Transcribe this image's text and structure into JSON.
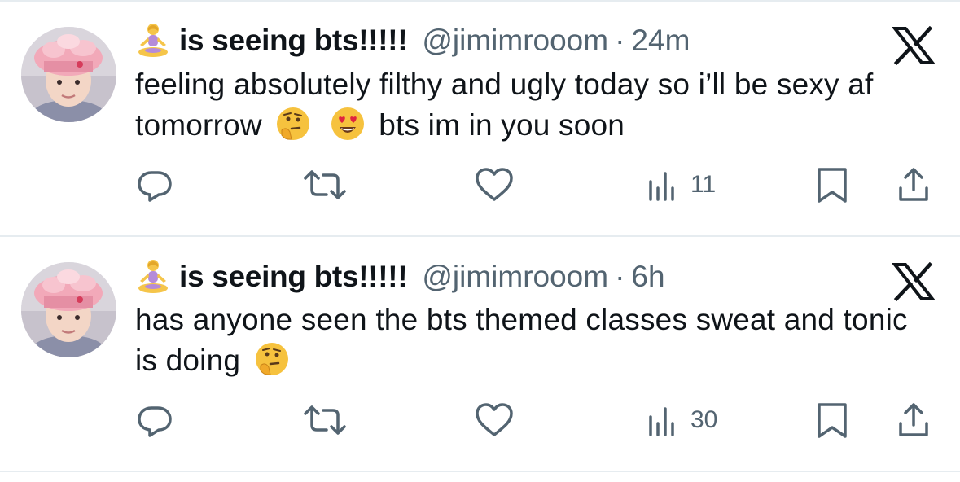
{
  "tweets": [
    {
      "display_name": "is seeing bts!!!!!",
      "handle": "@jimimrooom",
      "separator": "·",
      "time": "24m",
      "text_parts": [
        "feeling absolutely filthy and ugly today so i’ll be sexy af tomorrow",
        "bts im in you soon"
      ],
      "emojis": [
        "thinking-face-emoji",
        "heart-eyes-emoji"
      ],
      "views": "11"
    },
    {
      "display_name": "is seeing bts!!!!!",
      "handle": "@jimimrooom",
      "separator": "·",
      "time": "6h",
      "text_parts": [
        "has anyone seen the bts themed classes sweat and tonic is doing"
      ],
      "emojis": [
        "thinking-face-emoji"
      ],
      "views": "30"
    }
  ],
  "icons": {
    "name_emoji": "person-in-lotus-position-emoji",
    "platform": "x-logo-icon",
    "reply": "reply-icon",
    "retweet": "retweet-icon",
    "like": "heart-icon",
    "views": "views-icon",
    "bookmark": "bookmark-icon",
    "share": "share-icon"
  },
  "colors": {
    "icon_gray": "#536471",
    "text": "#0f1419",
    "divider": "#e6ecf0"
  }
}
